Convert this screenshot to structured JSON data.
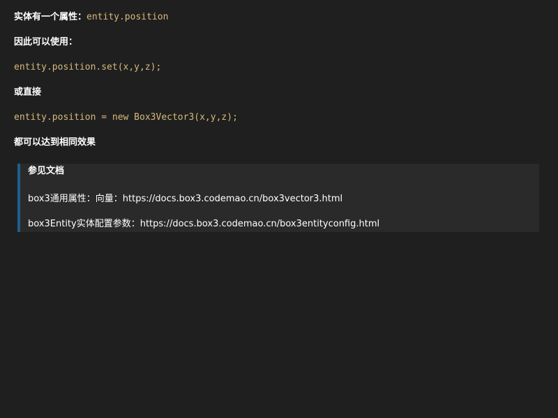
{
  "content": {
    "intro_label": "实体有一个属性：",
    "intro_code": "entity.position",
    "so_label": "因此可以使用：",
    "code_set": "entity.position.set(x,y,z);",
    "or_label": "或直接",
    "code_assign": "entity.position = new Box3Vector3(x,y,z);",
    "same_label": "都可以达到相同效果"
  },
  "callout": {
    "title": "参见文档",
    "link1": "box3通用属性：向量：https://docs.box3.codemao.cn/box3vector3.html",
    "link2": "box3Entity实体配置参数：https://docs.box3.codemao.cn/box3entityconfig.html"
  },
  "colors": {
    "background": "#1f1f1f",
    "code": "#d7ba7d",
    "callout_bg": "#2a2a2a",
    "callout_border": "#1e5f8f"
  }
}
